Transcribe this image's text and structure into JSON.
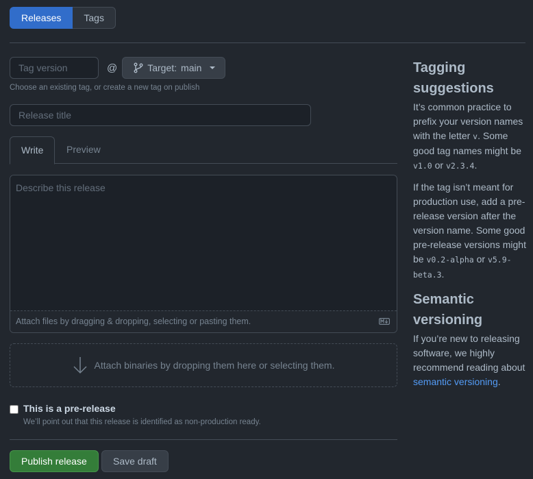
{
  "tabs": {
    "releases": "Releases",
    "tags": "Tags"
  },
  "form": {
    "tag_placeholder": "Tag version",
    "at": "@",
    "target_prefix": "Target:",
    "target_value": "main",
    "tag_hint": "Choose an existing tag, or create a new tag on publish",
    "title_placeholder": "Release title",
    "write_tab": "Write",
    "preview_tab": "Preview",
    "body_placeholder": "Describe this release",
    "attach_files": "Attach files by dragging & dropping, selecting or pasting them.",
    "attach_binaries": "Attach binaries by dropping them here or selecting them.",
    "prerelease_label": "This is a pre-release",
    "prerelease_note": "We’ll point out that this release is identified as non-production ready.",
    "publish": "Publish release",
    "save_draft": "Save draft"
  },
  "sidebar": {
    "tagging_title": "Tagging suggestions",
    "p1_a": "It’s common practice to prefix your version names with the letter ",
    "p1_v": "v",
    "p1_b": ". Some good tag names might be ",
    "p1_code1": "v1.0",
    "p1_or": " or ",
    "p1_code2": "v2.3.4",
    "p1_end": ".",
    "p2_a": "If the tag isn’t meant for production use, add a pre-release version after the version name. Some good pre-release versions might be ",
    "p2_code1": "v0.2-alpha",
    "p2_or": " or ",
    "p2_code2": "v5.9-beta.3",
    "p2_end": ".",
    "semantic_title": "Semantic versioning",
    "p3_a": "If you’re new to releasing software, we highly recommend reading about ",
    "p3_link": "semantic versioning",
    "p3_end": "."
  },
  "colors": {
    "accent": "#316dca",
    "publish": "#347d39",
    "link": "#539bf5",
    "background": "#22272e"
  }
}
